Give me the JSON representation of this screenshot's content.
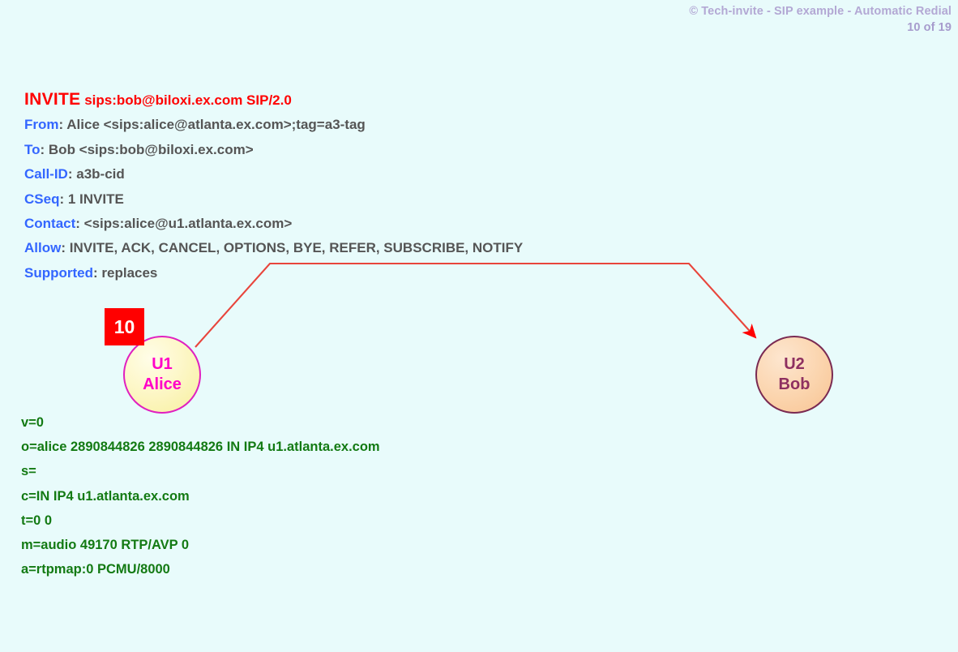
{
  "header": {
    "title": "© Tech-invite - SIP example - Automatic Redial",
    "page_indicator": "10 of 19"
  },
  "sip_message": {
    "request_line": {
      "method": "INVITE",
      "uri_and_version": "sips:bob@biloxi.ex.com SIP/2.0"
    },
    "headers": [
      {
        "name": "From",
        "separator": ": ",
        "value": "Alice <sips:alice@atlanta.ex.com>;tag=a3-tag"
      },
      {
        "name": "To",
        "separator": ": ",
        "value": "Bob <sips:bob@biloxi.ex.com>"
      },
      {
        "name": "Call-ID",
        "separator": ": ",
        "value": "a3b-cid"
      },
      {
        "name": "CSeq",
        "separator": ": ",
        "value": "1 INVITE"
      },
      {
        "name": "Contact",
        "separator": ": ",
        "value": "<sips:alice@u1.atlanta.ex.com>"
      },
      {
        "name": "Allow",
        "separator": ": ",
        "value": "INVITE, ACK, CANCEL, OPTIONS, BYE, REFER, SUBSCRIBE, NOTIFY"
      },
      {
        "name": "Supported",
        "separator": ": ",
        "value": "replaces"
      }
    ]
  },
  "sdp_body": {
    "lines": [
      "v=0",
      "o=alice  2890844826  2890844826  IN  IP4  u1.atlanta.ex.com",
      "s=",
      "c=IN  IP4  u1.atlanta.ex.com",
      "t=0  0",
      "m=audio  49170  RTP/AVP  0",
      "a=rtpmap:0  PCMU/8000"
    ]
  },
  "diagram": {
    "step_number": "10",
    "nodes": [
      {
        "id": "U1",
        "label_top": "U1",
        "label_bottom": "Alice"
      },
      {
        "id": "U2",
        "label_top": "U2",
        "label_bottom": "Bob"
      }
    ],
    "arrow": {
      "direction": "U1-to-U2",
      "color": "#e8453c"
    }
  },
  "colors": {
    "background": "#e8fbfb",
    "request_line": "#ff0000",
    "header_name": "#3366ff",
    "header_value": "#555555",
    "sdp_text": "#137a13",
    "header_watermark": "#b3a8d4",
    "badge_background": "#ff0000",
    "alice_border": "#e020c0",
    "alice_text": "#ff00c8",
    "bob_border": "#7a2a52",
    "bob_text": "#8e3060",
    "arrow": "#e8453c"
  }
}
